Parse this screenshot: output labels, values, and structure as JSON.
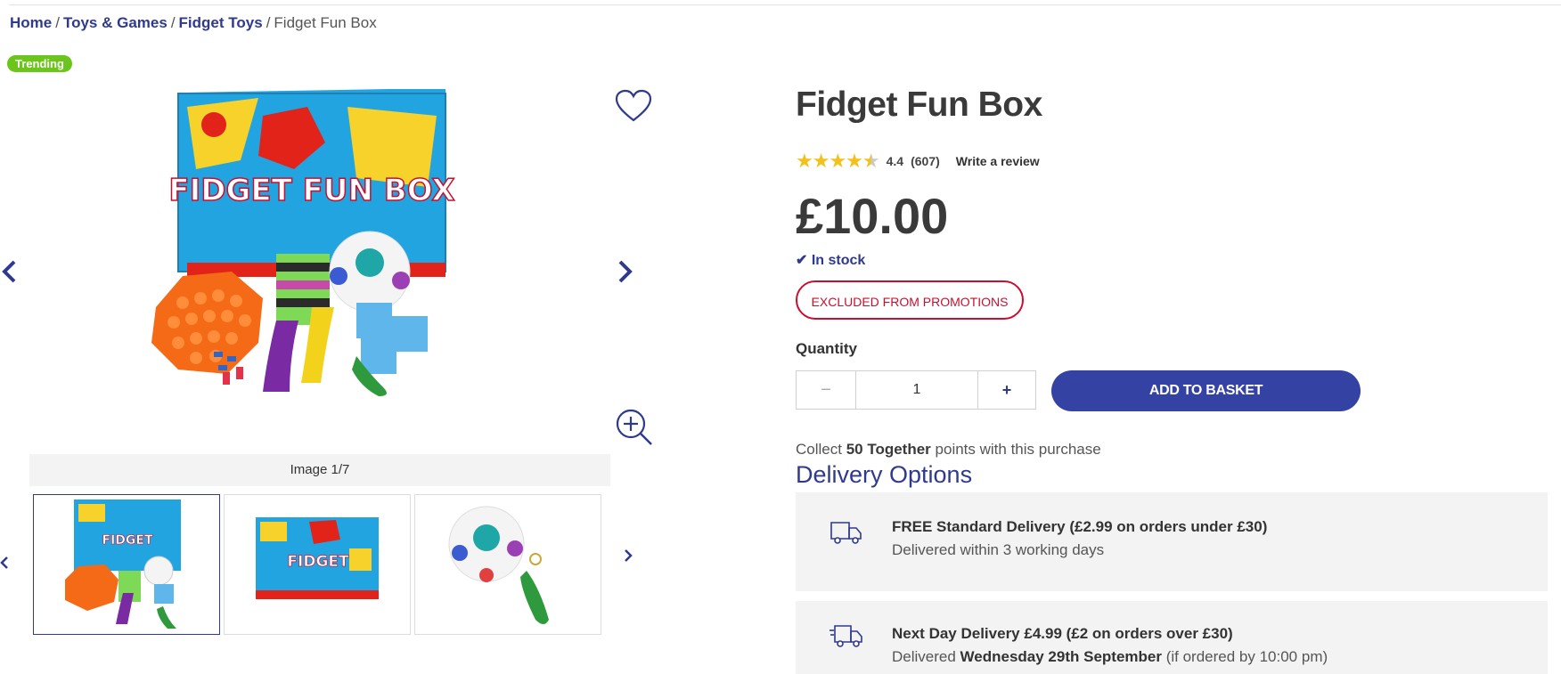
{
  "breadcrumb": {
    "items": [
      "Home",
      "Toys & Games",
      "Fidget Toys"
    ],
    "current": "Fidget Fun Box"
  },
  "badge": "Trending",
  "gallery": {
    "counter": "Image 1/7",
    "box_title": "FIDGET FUN BOX"
  },
  "product": {
    "title": "Fidget Fun Box",
    "rating": 4.4,
    "rating_text": "4.4",
    "review_count": "(607)",
    "write_review": "Write a review",
    "price": "£10.00",
    "stock": "In stock",
    "promo": "EXCLUDED FROM PROMOTIONS",
    "quantity_label": "Quantity",
    "quantity": "1",
    "minus": "−",
    "plus": "+",
    "add_to_basket": "ADD TO BASKET"
  },
  "points": {
    "prefix": "Collect",
    "amount": "50 Together",
    "suffix": "points with this purchase"
  },
  "delivery": {
    "heading": "Delivery Options",
    "options": [
      {
        "title": "FREE Standard Delivery (£2.99 on orders under £30)",
        "sub": "Delivered within 3 working days"
      },
      {
        "title": "Next Day Delivery £4.99 (£2 on orders over £30)",
        "sub_prefix": "Delivered",
        "sub_bold": "Wednesday 29th September",
        "sub_suffix": "(if ordered by 10:00 pm)"
      }
    ]
  },
  "colors": {
    "brand": "#2f3a8f",
    "button": "#3442a3",
    "promo": "#c8102e",
    "badge": "#6bc51a"
  }
}
